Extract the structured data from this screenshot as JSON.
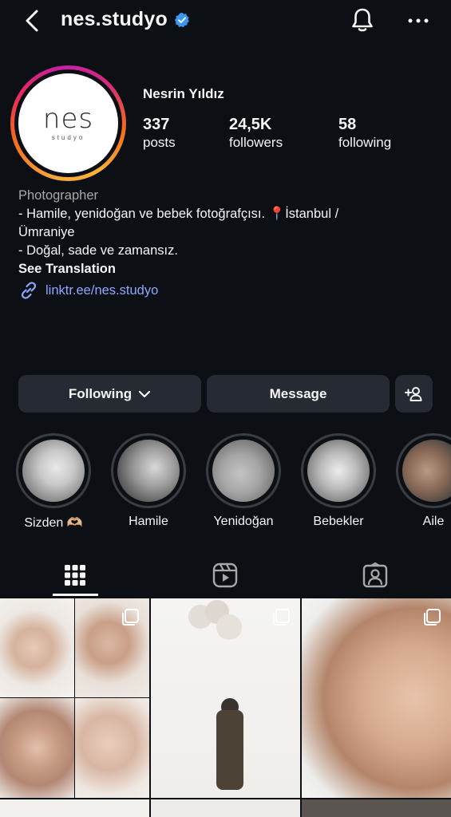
{
  "header": {
    "username": "nes.studyo",
    "verified": true
  },
  "profile": {
    "full_name": "Nesrin Yıldız",
    "avatar_logo_main": "nes",
    "avatar_logo_sub": "studyo",
    "stats": [
      {
        "value": "337",
        "label": "posts"
      },
      {
        "value": "24,5K",
        "label": "followers"
      },
      {
        "value": "58",
        "label": "following"
      }
    ],
    "category": "Photographer",
    "bio_lines": [
      "- Hamile, yenidoğan ve bebek fotoğrafçısı. 📍İstanbul /",
      "Ümraniye",
      "- Doğal, sade ve zamansız."
    ],
    "see_translation": "See Translation",
    "link": "linktr.ee/nes.studyo"
  },
  "actions": {
    "following_label": "Following",
    "message_label": "Message"
  },
  "highlights": [
    {
      "label": "Sizden 🫶🏼"
    },
    {
      "label": "Hamile"
    },
    {
      "label": "Yenidoğan"
    },
    {
      "label": "Bebekler"
    },
    {
      "label": "Aile"
    }
  ],
  "tabs": [
    "grid-icon",
    "reels-icon",
    "tagged-icon"
  ],
  "colors": {
    "background": "#0c0f14",
    "button": "#262a33",
    "link": "#8fa8ff",
    "verified": "#3897f0"
  }
}
